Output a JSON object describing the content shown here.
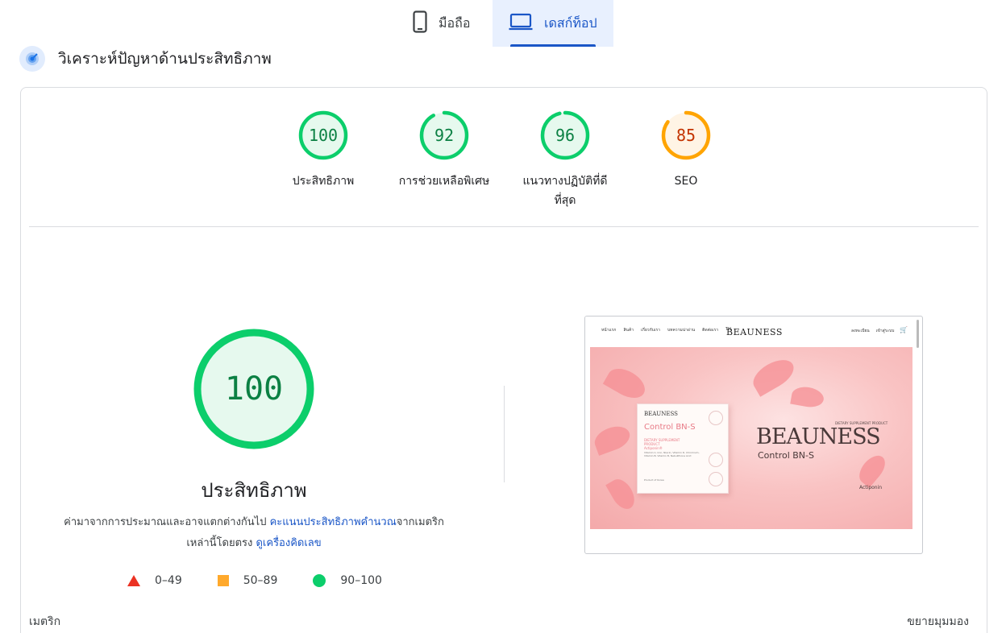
{
  "tabs": {
    "mobile_label": "มือถือ",
    "desktop_label": "เดสก์ท็อป"
  },
  "header": {
    "title": "วิเคราะห์ปัญหาด้านประสิทธิภาพ"
  },
  "gauges": [
    {
      "score": "100",
      "label": "ประสิทธิภาพ",
      "status": "good"
    },
    {
      "score": "92",
      "label": "การช่วยเหลือพิเศษ",
      "status": "good"
    },
    {
      "score": "96",
      "label": "แนวทางปฏิบัติที่ดีที่สุด",
      "status": "good"
    },
    {
      "score": "85",
      "label": "SEO",
      "status": "average"
    }
  ],
  "performance": {
    "score": "100",
    "title": "ประสิทธิภาพ",
    "desc_prefix": "ค่ามาจากการประมาณและอาจแตกต่างกันไป ",
    "desc_link1": "คะแนนประสิทธิภาพคำนวณ",
    "desc_mid": "จากเมตริกเหล่านี้โดยตรง ",
    "desc_link2": "ดูเครื่องคิดเลข"
  },
  "legend": {
    "fail": "0–49",
    "average": "50–89",
    "pass": "90–100"
  },
  "footer": {
    "metrics_label": "เมตริก",
    "expand_label": "ขยายมุมมอง"
  },
  "thumbnail": {
    "nav_links": [
      "หน้าแรก",
      "สินค้า",
      "เกี่ยวกับเรา",
      "บทความน่าอ่าน",
      "ติดต่อเรา",
      "TH"
    ],
    "logo": "BEAUNESS",
    "right_links": [
      "ลงทะเบียน",
      "เข้าสู่ระบบ"
    ],
    "box_logo": "BEAUNESS",
    "box_product": "Control BN-S",
    "box_sub": "DIETARY SUPPLEMENT PRODUCT",
    "box_ingredient": "Actiponin®",
    "box_lines": "Vitamin C, Iron, Niacin, Vitamin D, Chromium, Vitamin B, Vitamin B, Nebulithone Acid",
    "box_foot": "Product of Korea",
    "hero_kicker": "DIETARY SUPPLEMENT PRODUCT",
    "hero_brand": "BEAUNESS",
    "hero_product": "Control BN-S",
    "hero_tag": "Actiponin"
  },
  "colors": {
    "accent": "#1a56c7",
    "pass": "#0cce6b",
    "pass_text": "#0b8043",
    "pass_fill": "#e6f9ee",
    "average": "#ffa400",
    "average_text": "#c33300",
    "average_fill": "#fff4e5",
    "fail": "#eb3223"
  }
}
